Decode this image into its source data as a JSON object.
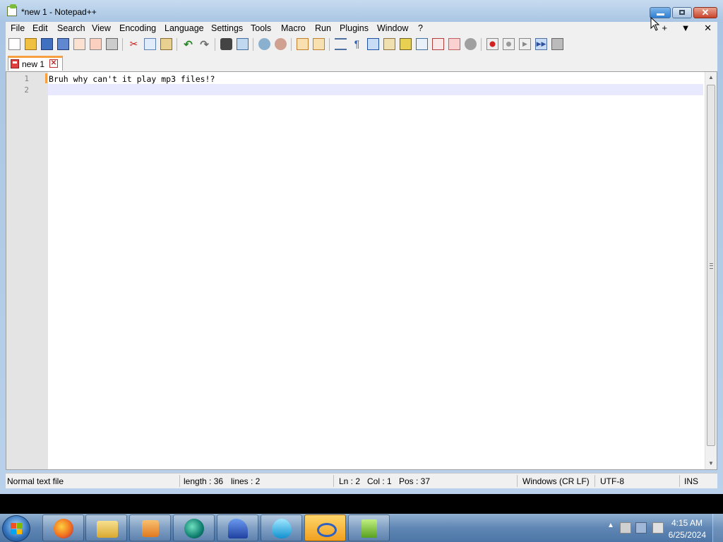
{
  "window": {
    "title": "*new 1 - Notepad++"
  },
  "menu": {
    "items": [
      "File",
      "Edit",
      "Search",
      "View",
      "Encoding",
      "Language",
      "Settings",
      "Tools",
      "Macro",
      "Run",
      "Plugins",
      "Window",
      "?"
    ],
    "right_controls": [
      "+",
      "▼",
      "✕"
    ]
  },
  "toolbar": {
    "icons": [
      "new-file-icon",
      "open-file-icon",
      "save-icon",
      "save-all-icon",
      "close-icon",
      "close-all-icon",
      "print-icon",
      "cut-icon",
      "copy-icon",
      "paste-icon",
      "undo-icon",
      "redo-icon",
      "find-icon",
      "replace-icon",
      "zoom-in-icon",
      "zoom-out-icon",
      "sync-vertical-icon",
      "sync-horizontal-icon",
      "word-wrap-icon",
      "show-all-chars-icon",
      "indent-guide-icon",
      "udl-icon",
      "doc-map-icon",
      "function-list-icon",
      "folder-as-workspace-icon",
      "monitoring-icon",
      "record-macro-icon",
      "stop-record-icon",
      "play-macro-icon",
      "run-macro-multiple-icon",
      "save-macro-icon"
    ]
  },
  "tabs": [
    {
      "label": "new 1",
      "modified": true
    }
  ],
  "editor": {
    "lines": [
      {
        "number": "1",
        "text": "Bruh why can't it play mp3 files!?"
      },
      {
        "number": "2",
        "text": ""
      }
    ]
  },
  "status": {
    "file_type": "Normal text file",
    "length": "length : 36",
    "lines": "lines : 2",
    "ln": "Ln : 2",
    "col": "Col : 1",
    "pos": "Pos : 37",
    "eol": "Windows (CR LF)",
    "encoding": "UTF-8",
    "mode": "INS"
  },
  "taskbar": {
    "apps": [
      "firefox-icon",
      "file-explorer-icon",
      "media-player-icon",
      "app-icon-green",
      "app-icon-blue-sail",
      "water-drop-app-icon",
      "infinity-app-icon",
      "notepadpp-icon"
    ],
    "active_app": "infinity-app-icon",
    "clock_time": "4:15 AM",
    "clock_date": "6/25/2024"
  }
}
